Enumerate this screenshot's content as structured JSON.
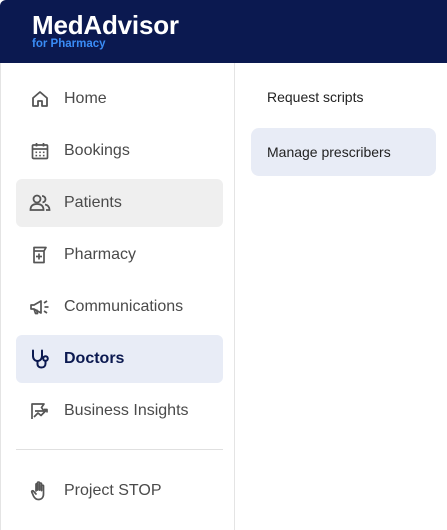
{
  "brand": {
    "title": "MedAdvisor",
    "subtitle": "for Pharmacy"
  },
  "sidebar": {
    "items": [
      {
        "label": "Home",
        "icon": "home-icon"
      },
      {
        "label": "Bookings",
        "icon": "calendar-icon"
      },
      {
        "label": "Patients",
        "icon": "patients-icon"
      },
      {
        "label": "Pharmacy",
        "icon": "pharmacy-icon"
      },
      {
        "label": "Communications",
        "icon": "megaphone-icon"
      },
      {
        "label": "Doctors",
        "icon": "stethoscope-icon"
      },
      {
        "label": "Business Insights",
        "icon": "insights-icon"
      },
      {
        "label": "Project STOP",
        "icon": "hand-icon"
      }
    ],
    "active_item": "Doctors",
    "hover_item": "Patients"
  },
  "submenu": {
    "items": [
      {
        "label": "Request scripts"
      },
      {
        "label": "Manage prescribers"
      }
    ],
    "active_item": "Manage prescribers"
  },
  "colors": {
    "header_bg": "#0b1950",
    "brand_sub": "#3a8cf6",
    "active_bg": "#e8ecf6",
    "hover_bg": "#efefef",
    "active_text": "#0b1950"
  }
}
